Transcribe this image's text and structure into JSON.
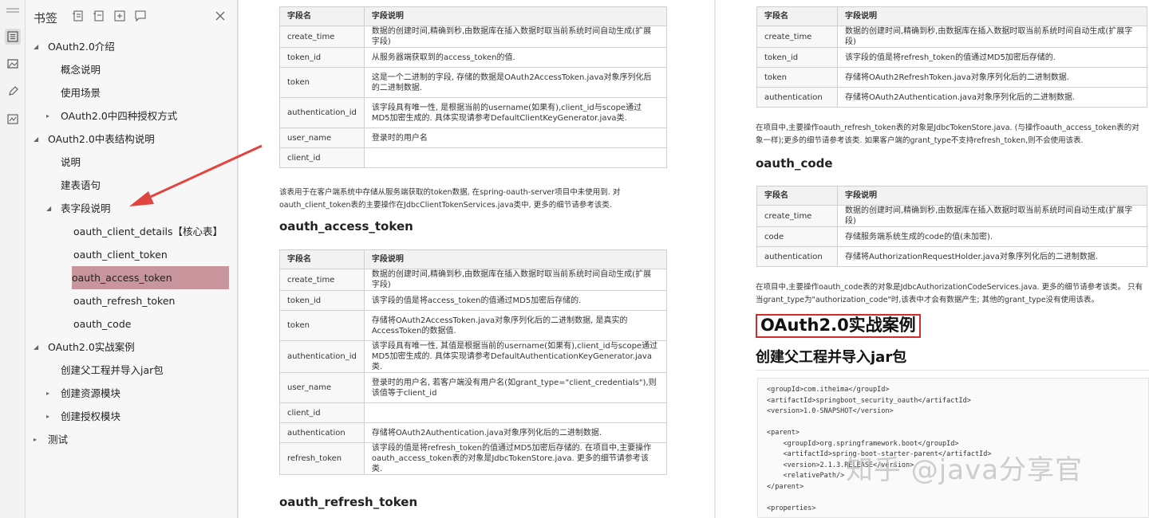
{
  "sidebar": {
    "title": "书签",
    "tree": [
      {
        "label": "OAuth2.0介绍",
        "level": 0,
        "expand": "open"
      },
      {
        "label": "概念说明",
        "level": 1,
        "expand": "none"
      },
      {
        "label": "使用场景",
        "level": 1,
        "expand": "none"
      },
      {
        "label": "OAuth2.0中四种授权方式",
        "level": 1,
        "expand": "closed"
      },
      {
        "label": "OAuth2.0中表结构说明",
        "level": 0,
        "expand": "open"
      },
      {
        "label": "说明",
        "level": 1,
        "expand": "none"
      },
      {
        "label": "建表语句",
        "level": 1,
        "expand": "none"
      },
      {
        "label": "表字段说明",
        "level": 1,
        "expand": "open"
      },
      {
        "label": "oauth_client_details【核心表】",
        "level": 2,
        "expand": "none"
      },
      {
        "label": "oauth_client_token",
        "level": 2,
        "expand": "none"
      },
      {
        "label": "oauth_access_token",
        "level": 2,
        "expand": "none",
        "selected": true
      },
      {
        "label": "oauth_refresh_token",
        "level": 2,
        "expand": "none"
      },
      {
        "label": "oauth_code",
        "level": 2,
        "expand": "none"
      },
      {
        "label": "OAuth2.0实战案例",
        "level": 0,
        "expand": "open"
      },
      {
        "label": "创建父工程并导入jar包",
        "level": 1,
        "expand": "none"
      },
      {
        "label": "创建资源模块",
        "level": 1,
        "expand": "closed"
      },
      {
        "label": "创建授权模块",
        "level": 1,
        "expand": "closed"
      },
      {
        "label": "测试",
        "level": 0,
        "expand": "closed"
      }
    ]
  },
  "page1": {
    "table_client_token": {
      "headers": [
        "字段名",
        "字段说明"
      ],
      "rows": [
        [
          "create_time",
          "数据的创建时间,精确到秒,由数据库在插入数据时取当前系统时间自动生成(扩展字段)"
        ],
        [
          "token_id",
          "从服务器端获取到的access_token的值."
        ],
        [
          "token",
          "这是一个二进制的字段, 存储的数据是OAuth2AccessToken.java对象序列化后的二进制数据."
        ],
        [
          "authentication_id",
          "该字段具有唯一性, 是根据当前的username(如果有),client_id与scope通过MD5加密生成的. 具体实现请参考DefaultClientKeyGenerator.java类."
        ],
        [
          "user_name",
          "登录时的用户名"
        ],
        [
          "client_id",
          ""
        ]
      ]
    },
    "para_client_token": "该表用于在客户端系统中存储从服务端获取的token数据, 在spring-oauth-server项目中未使用到. 对oauth_client_token表的主要操作在JdbcClientTokenServices.java类中, 更多的细节请参考该类.",
    "heading_access_token": "oauth_access_token",
    "table_access_token": {
      "headers": [
        "字段名",
        "字段说明"
      ],
      "rows": [
        [
          "create_time",
          "数据的创建时间,精确到秒,由数据库在插入数据时取当前系统时间自动生成(扩展字段)"
        ],
        [
          "token_id",
          "该字段的值是将access_token的值通过MD5加密后存储的."
        ],
        [
          "token",
          "存储将OAuth2AccessToken.java对象序列化后的二进制数据, 是真实的AccessToken的数据值."
        ],
        [
          "authentication_id",
          "该字段具有唯一性, 其值是根据当前的username(如果有),client_id与scope通过MD5加密生成的. 具体实现请参考DefaultAuthenticationKeyGenerator.java类."
        ],
        [
          "user_name",
          "登录时的用户名, 若客户端没有用户名(如grant_type=\"client_credentials\"),则该值等于client_id"
        ],
        [
          "client_id",
          ""
        ],
        [
          "authentication",
          "存储将OAuth2Authentication.java对象序列化后的二进制数据."
        ],
        [
          "refresh_token",
          "该字段的值是将refresh_token的值通过MD5加密后存储的. 在项目中,主要操作oauth_access_token表的对象是JdbcTokenStore.java. 更多的细节请参考该类."
        ]
      ]
    },
    "heading_refresh_token": "oauth_refresh_token"
  },
  "page2": {
    "table_refresh_token": {
      "headers": [
        "字段名",
        "字段说明"
      ],
      "rows": [
        [
          "create_time",
          "数据的创建时间,精确到秒,由数据库在插入数据时取当前系统时间自动生成(扩展字段)"
        ],
        [
          "token_id",
          "该字段的值是将refresh_token的值通过MD5加密后存储的."
        ],
        [
          "token",
          "存储将OAuth2RefreshToken.java对象序列化后的二进制数据."
        ],
        [
          "authentication",
          "存储将OAuth2Authentication.java对象序列化后的二进制数据."
        ]
      ]
    },
    "para_refresh_token": "在项目中,主要操作oauth_refresh_token表的对象是JdbcTokenStore.java. (与操作oauth_access_token表的对象一样);更多的细节请参考该类. 如果客户端的grant_type不支持refresh_token,则不会使用该表.",
    "heading_code": "oauth_code",
    "table_code": {
      "headers": [
        "字段名",
        "字段说明"
      ],
      "rows": [
        [
          "create_time",
          "数据的创建时间,精确到秒,由数据库在插入数据时取当前系统时间自动生成(扩展字段)"
        ],
        [
          "code",
          "存储服务端系统生成的code的值(未加密)."
        ],
        [
          "authentication",
          "存储将AuthorizationRequestHolder.java对象序列化后的二进制数据."
        ]
      ]
    },
    "para_code": "在项目中,主要操作oauth_code表的对象是JdbcAuthorizationCodeServices.java. 更多的细节请参考该类。 只有当grant_type为\"authorization_code\"时,该表中才会有数据产生; 其他的grant_type没有使用该表。",
    "heading_case": "OAuth2.0实战案例",
    "heading_parent": "创建父工程并导入jar包",
    "code_lines": [
      "<groupId>com.itheima</groupId>",
      "<artifactId>springboot_security_oauth</artifactId>",
      "<version>1.0-SNAPSHOT</version>",
      "",
      "<parent>",
      "    <groupId>org.springframework.boot</groupId>",
      "    <artifactId>spring-boot-starter-parent</artifactId>",
      "    <version>2.1.3.RELEASE</version>",
      "    <relativePath/>",
      "</parent>",
      "",
      "<properties>"
    ]
  },
  "watermark": "知乎 @java分享官",
  "colors": {
    "selected_bg": "#c9959c",
    "annotation_red": "#d12b2b"
  }
}
